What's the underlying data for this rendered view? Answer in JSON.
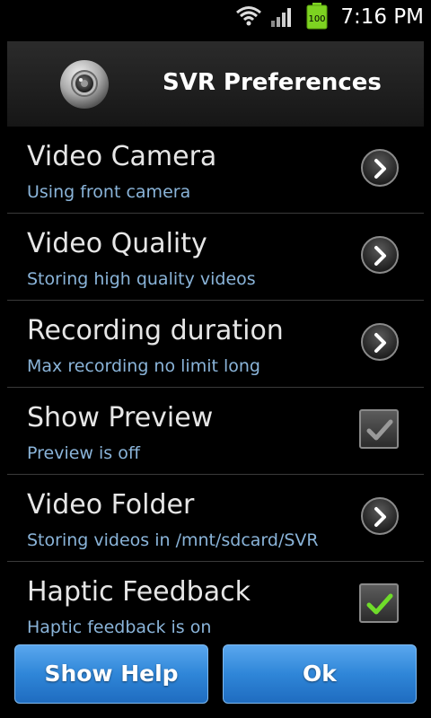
{
  "status_bar": {
    "time": "7:16 PM",
    "battery_level": "100",
    "icons": [
      "wifi-icon",
      "signal-icon",
      "battery-icon"
    ]
  },
  "header": {
    "title": "SVR Preferences",
    "icon": "camera-lens-icon"
  },
  "preferences": [
    {
      "title": "Video Camera",
      "summary": "Using front camera",
      "control": "chevron"
    },
    {
      "title": "Video Quality",
      "summary": "Storing high quality videos",
      "control": "chevron"
    },
    {
      "title": "Recording duration",
      "summary": "Max recording no limit long",
      "control": "chevron"
    },
    {
      "title": "Show Preview",
      "summary": "Preview is off",
      "control": "checkbox",
      "checked": false
    },
    {
      "title": "Video Folder",
      "summary": "Storing videos in /mnt/sdcard/SVR",
      "control": "chevron"
    },
    {
      "title": "Haptic Feedback",
      "summary": "Haptic feedback is on",
      "control": "checkbox",
      "checked": true
    }
  ],
  "buttons": {
    "help_label": "Show Help",
    "ok_label": "Ok"
  },
  "colors": {
    "summary_text": "#8ab4d9",
    "button_blue": "#2f86d8",
    "check_green": "#6fdc2a"
  }
}
